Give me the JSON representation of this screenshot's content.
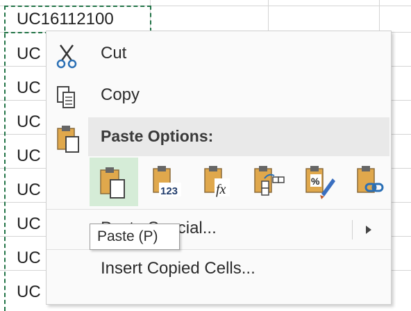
{
  "worksheet": {
    "cells": [
      "UC16112100",
      "UC",
      "UC",
      "UC",
      "UC",
      "UC",
      "UC",
      "UC",
      "UC"
    ]
  },
  "context_menu": {
    "cut_label": "Cut",
    "copy_label": "Copy",
    "paste_options_label": "Paste Options:",
    "paste_special_label": "Paste Special...",
    "insert_copied_label": "Insert Copied Cells...",
    "paste_buttons": [
      {
        "icon": "paste-icon"
      },
      {
        "icon": "paste-values-icon",
        "badge": "123"
      },
      {
        "icon": "paste-formulas-icon",
        "badge": "fx"
      },
      {
        "icon": "paste-transpose-icon"
      },
      {
        "icon": "paste-formatting-icon",
        "badge": "%"
      },
      {
        "icon": "paste-link-icon"
      }
    ]
  },
  "tooltip": {
    "text": "Paste (P)"
  },
  "colors": {
    "accent": "#217346",
    "hover": "#d5ecd7",
    "clipboard": "#e0a84c"
  }
}
